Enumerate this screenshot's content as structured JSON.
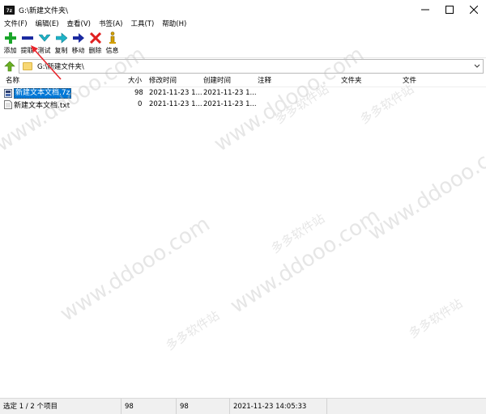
{
  "window": {
    "title": "G:\\新建文件夹\\"
  },
  "menu": [
    "文件(F)",
    "编辑(E)",
    "查看(V)",
    "书签(A)",
    "工具(T)",
    "帮助(H)"
  ],
  "toolbar": [
    {
      "label": "添加",
      "icon": "plus-icon",
      "color": "#1aa52a"
    },
    {
      "label": "提取",
      "icon": "minus-icon",
      "color": "#1b2aa0"
    },
    {
      "label": "测试",
      "icon": "check-arrow-icon",
      "color": "#1fb3c7"
    },
    {
      "label": "复制",
      "icon": "copy-arrow-icon",
      "color": "#1fb3c7"
    },
    {
      "label": "移动",
      "icon": "move-arrow-icon",
      "color": "#1b2aa0"
    },
    {
      "label": "删除",
      "icon": "delete-x-icon",
      "color": "#e02020"
    },
    {
      "label": "信息",
      "icon": "info-icon",
      "color": "#d4a000"
    }
  ],
  "address": {
    "path": "G:\\新建文件夹\\"
  },
  "columns": [
    "名称",
    "大小",
    "修改时间",
    "创建时间",
    "注释",
    "文件夹",
    "文件"
  ],
  "files": [
    {
      "name": "新建文本文档.7z",
      "size": "98",
      "modified": "2021-11-23 1...",
      "created": "2021-11-23 1...",
      "selected": true
    },
    {
      "name": "新建文本文档.txt",
      "size": "0",
      "modified": "2021-11-23 1...",
      "created": "2021-11-23 1...",
      "selected": false
    }
  ],
  "status": {
    "selection": "选定 1 / 2 个项目",
    "size1": "98",
    "size2": "98",
    "datetime": "2021-11-23 14:05:33"
  },
  "watermark": {
    "url": "www.ddooo.com",
    "cn": "多多软件站"
  },
  "colors": {
    "selection": "#0078d7",
    "annotation_arrow": "#e8242b"
  }
}
